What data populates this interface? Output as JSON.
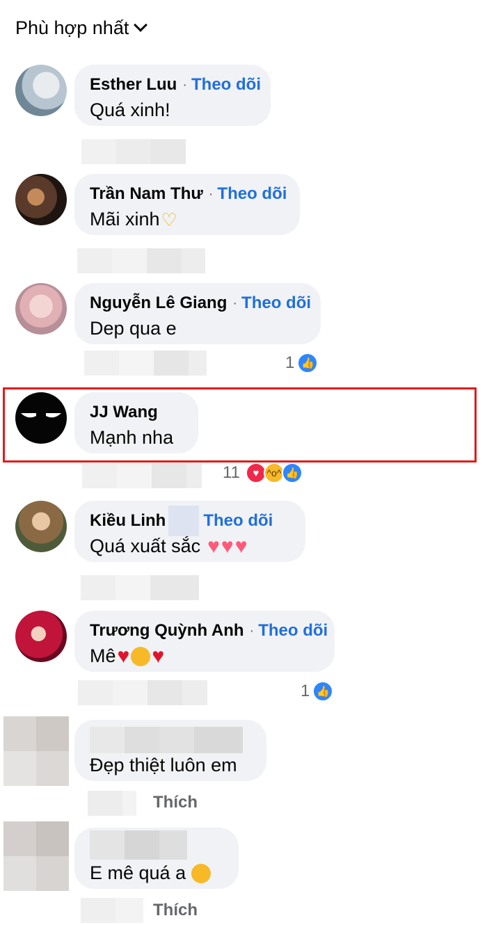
{
  "sort": {
    "label": "Phù hợp nhất"
  },
  "comments": [
    {
      "author": "Esther Luu",
      "follow": "Theo dõi",
      "text": "Quá xinh!",
      "reactions": ""
    },
    {
      "author": "Trần Nam Thư",
      "follow": "Theo dõi",
      "text": "Mãi xinh",
      "reactions": ""
    },
    {
      "author": "Nguyễn Lê Giang",
      "follow": "Theo dõi",
      "text": "Dep qua e",
      "reactions": "1"
    },
    {
      "author": "JJ Wang",
      "follow": "",
      "text": "Mạnh nha",
      "reactions": "11"
    },
    {
      "author": "Kiều Linh",
      "follow": "Theo dõi",
      "text": "Quá xuất sắc",
      "reactions": ""
    },
    {
      "author": "Trương Quỳnh Anh",
      "follow": "Theo dõi",
      "text": "Mê",
      "reactions": "1"
    },
    {
      "author": "",
      "follow": "",
      "text": "Đẹp thiệt luôn em",
      "action": "Thích"
    },
    {
      "author": "",
      "follow": "",
      "text": "E mê quá a",
      "action": "Thích"
    }
  ],
  "icons": {
    "sort_chevron": "chevron-down-icon",
    "like": "thumbs-up-icon",
    "love": "heart-icon",
    "haha": "laughing-face-icon"
  },
  "colors": {
    "follow": "#216fdb",
    "highlight_border": "#e01b1b",
    "bubble": "#f0f2f5"
  }
}
